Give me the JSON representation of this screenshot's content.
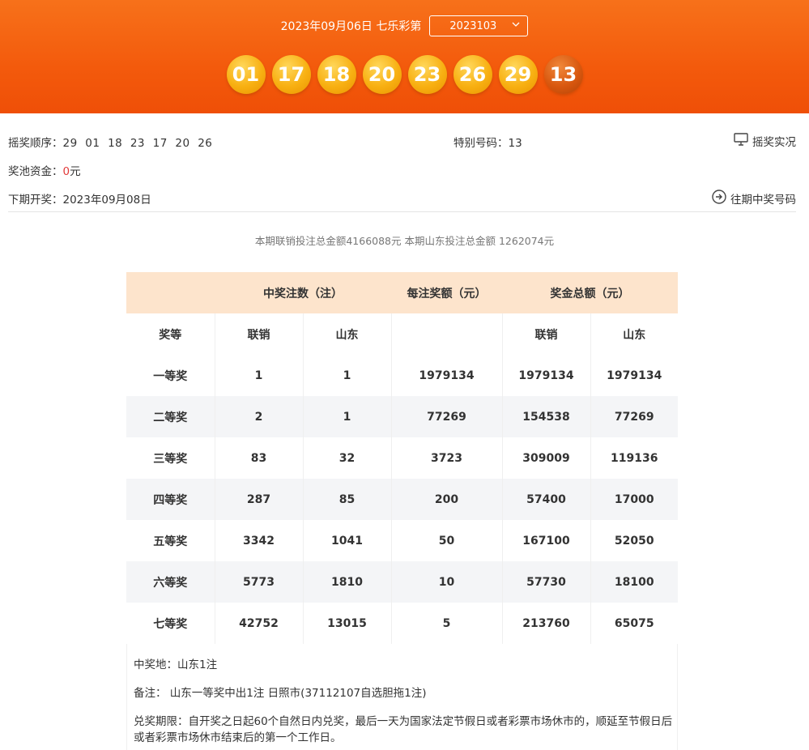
{
  "header": {
    "date_text": "2023年09月06日 七乐彩第",
    "issue": "2023103",
    "numbers": [
      "01",
      "17",
      "18",
      "20",
      "23",
      "26",
      "29"
    ],
    "special": "13"
  },
  "info": {
    "order_label": "摇奖顺序：",
    "order": [
      "29",
      "01",
      "18",
      "23",
      "17",
      "20",
      "26"
    ],
    "special_label": "特别号码：",
    "special_value": "13",
    "live_label": "摇奖实况",
    "pool_label": "奖池资金：",
    "pool_value": "0",
    "pool_unit": "元",
    "next_label": "下期开奖：",
    "next_value": "2023年09月08日",
    "history_label": "往期中奖号码"
  },
  "summary": "本期联销投注总金额4166088元 本期山东投注总金额 1262074元",
  "table": {
    "group_headers": [
      "中奖注数（注）",
      "每注奖额（元）",
      "奖金总额（元）"
    ],
    "sub_headers": [
      "奖等",
      "联销",
      "山东",
      "",
      "联销",
      "山东"
    ],
    "rows": [
      [
        "一等奖",
        "1",
        "1",
        "1979134",
        "1979134",
        "1979134"
      ],
      [
        "二等奖",
        "2",
        "1",
        "77269",
        "154538",
        "77269"
      ],
      [
        "三等奖",
        "83",
        "32",
        "3723",
        "309009",
        "119136"
      ],
      [
        "四等奖",
        "287",
        "85",
        "200",
        "57400",
        "17000"
      ],
      [
        "五等奖",
        "3342",
        "1041",
        "50",
        "167100",
        "52050"
      ],
      [
        "六等奖",
        "5773",
        "1810",
        "10",
        "57730",
        "18100"
      ],
      [
        "七等奖",
        "42752",
        "13015",
        "5",
        "213760",
        "65075"
      ]
    ]
  },
  "notes": {
    "winning_place": "中奖地：山东1注",
    "remark": "备注： 山东一等奖中出1注 日照市(37112107自选胆拖1注)",
    "deadline": "兑奖期限：自开奖之日起60个自然日内兑奖，最后一天为国家法定节假日或者彩票市场休市的，顺延至节假日后或者彩票市场休市结束后的第一个工作日。"
  },
  "colors": {
    "banner": "#f35a0c",
    "ball": "#f8b012",
    "special_ball": "#d9580f",
    "header_row": "#fde4cc"
  }
}
